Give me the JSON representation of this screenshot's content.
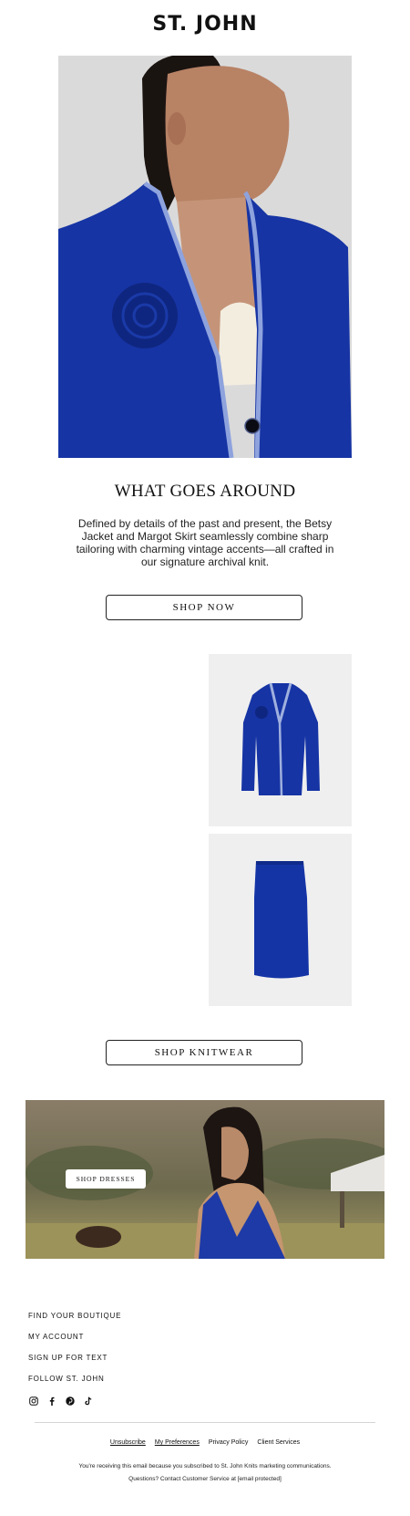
{
  "brand": {
    "logo": "ST. JOHN"
  },
  "hero": {
    "image_alt": "model in blue knit jacket"
  },
  "editorial": {
    "headline": "WHAT GOES AROUND",
    "body": "Defined by details of the past and present, the Betsy Jacket and Margot Skirt seamlessly combine sharp tailoring with charming vintage accents—all crafted in our signature archival knit.",
    "cta": "SHOP NOW"
  },
  "products": {
    "items": [
      {
        "name": "Betsy Jacket"
      },
      {
        "name": "Margot Skirt"
      }
    ],
    "cta": "SHOP KNITWEAR"
  },
  "banner": {
    "cta": "SHOP DRESSES"
  },
  "footer": {
    "links": [
      "FIND YOUR BOUTIQUE",
      "MY ACCOUNT",
      "SIGN UP FOR TEXT",
      "FOLLOW ST. JOHN"
    ],
    "socials": [
      "instagram-icon",
      "facebook-icon",
      "pinterest-icon",
      "tiktok-icon"
    ],
    "legal": [
      "Unsubscribe",
      "My Preferences",
      "Privacy Policy",
      "Client Services"
    ],
    "notice": "You're receiving this email because you subscribed to St. John Knits marketing communications.",
    "contact": "Questions? Contact Customer Service at [email protected]"
  },
  "colors": {
    "royal_blue": "#1e3aa8",
    "tile_bg": "#efefef",
    "text": "#111111"
  }
}
